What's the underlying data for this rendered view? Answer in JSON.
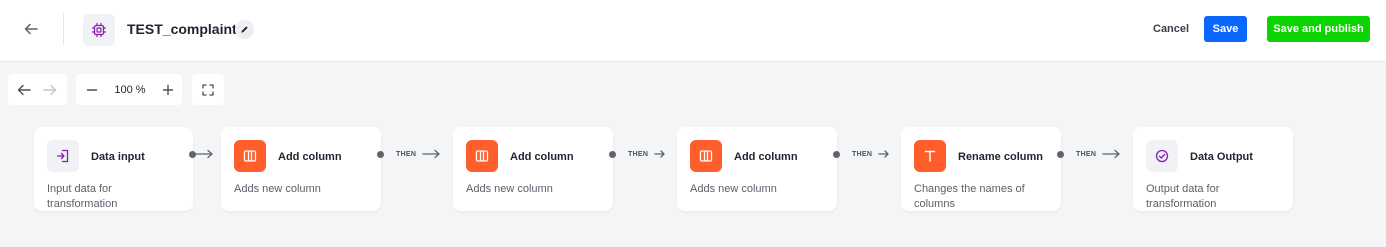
{
  "header": {
    "title": "TEST_complaint",
    "cancel_label": "Cancel",
    "save_label": "Save",
    "publish_label": "Save and publish"
  },
  "toolbar": {
    "zoom": "100 %"
  },
  "connector_label": "THEN",
  "nodes": [
    {
      "title": "Data input",
      "description": "Input data for transformation",
      "icon": "data-input-icon"
    },
    {
      "title": "Add column",
      "description": "Adds new column",
      "icon": "add-column-icon"
    },
    {
      "title": "Add column",
      "description": "Adds new column",
      "icon": "add-column-icon"
    },
    {
      "title": "Add column",
      "description": "Adds new column",
      "icon": "add-column-icon"
    },
    {
      "title": "Rename column",
      "description": "Changes the names of columns",
      "icon": "rename-column-icon"
    },
    {
      "title": "Data Output",
      "description": "Output data for transformation",
      "icon": "data-output-icon"
    }
  ],
  "colors": {
    "primary": "#0b68ff",
    "publish": "#0bd400",
    "node_accent": "#ff5e2b",
    "brand": "#8a1fb3"
  }
}
